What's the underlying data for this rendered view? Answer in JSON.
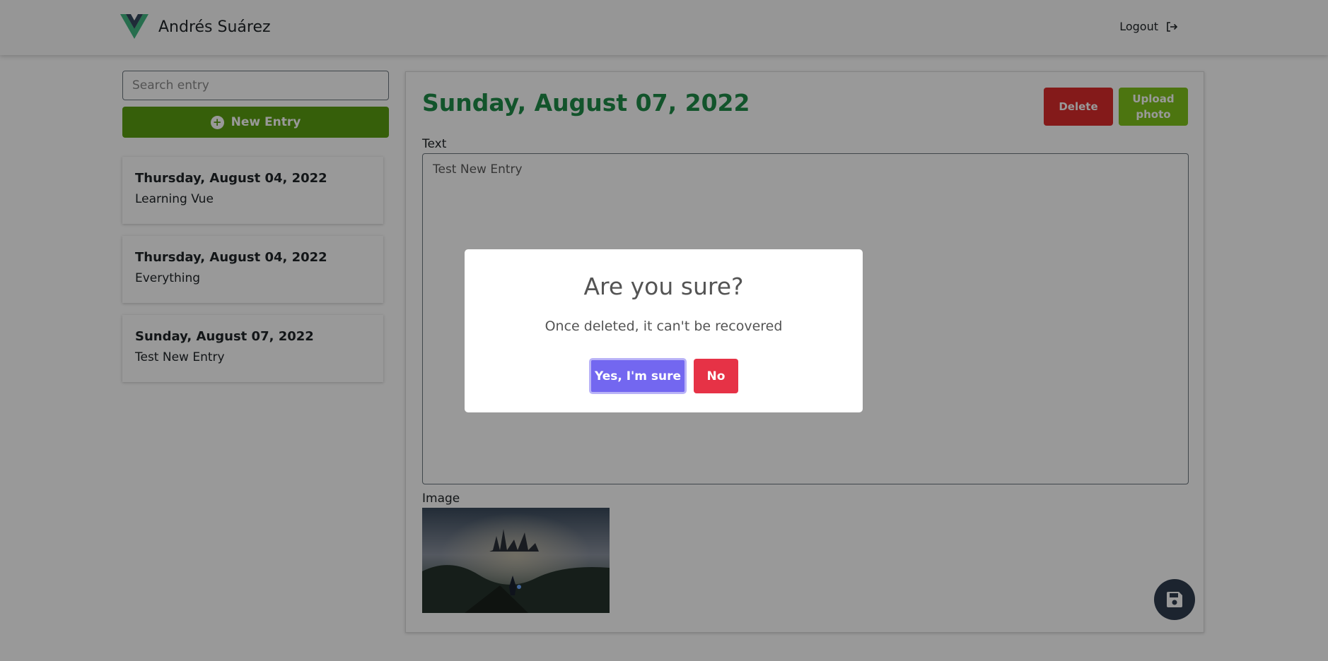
{
  "navbar": {
    "user_name": "Andrés Suárez",
    "logout_label": "Logout"
  },
  "sidebar": {
    "search_placeholder": "Search entry",
    "new_entry_label": "New Entry",
    "entries": [
      {
        "date": "Thursday, August 04, 2022",
        "text": "Learning Vue"
      },
      {
        "date": "Thursday, August 04, 2022",
        "text": "Everything"
      },
      {
        "date": "Sunday, August 07, 2022",
        "text": "Test New Entry"
      }
    ]
  },
  "entry": {
    "date_title": "Sunday, August 07, 2022",
    "delete_label": "Delete",
    "upload_label_line1": "Upload",
    "upload_label_line2": "photo",
    "text_label": "Text",
    "text_value": "Test New Entry",
    "image_label": "Image"
  },
  "dialog": {
    "title": "Are you sure?",
    "message": "Once deleted, it can't be recovered",
    "confirm_label": "Yes, I'm sure",
    "cancel_label": "No"
  },
  "colors": {
    "title_green": "#1e8c48",
    "new_entry_green": "#5a9e12",
    "delete_red": "#dc2c2c",
    "upload_green": "#7fc41c",
    "confirm_purple": "#7367f0",
    "cancel_red": "#e63246",
    "fab_dark": "#2f3d4f"
  },
  "icons": {
    "brand": "vue-logo-icon",
    "logout": "logout-icon",
    "new_entry": "plus-circle-icon",
    "save": "save-floppy-icon"
  }
}
